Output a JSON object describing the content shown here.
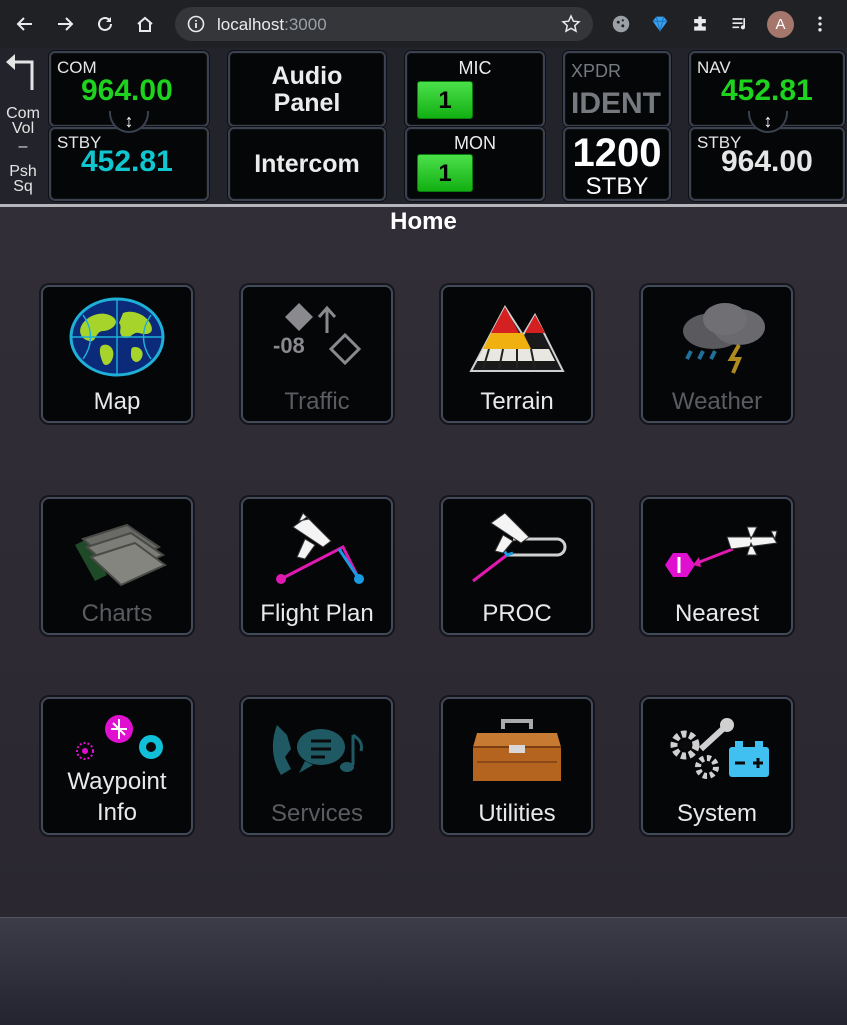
{
  "browser": {
    "url_host": "localhost",
    "url_port": ":3000",
    "avatar_letter": "A"
  },
  "side_control": {
    "line1": "Com",
    "line2": "Vol",
    "line3": "–",
    "line4": "Psh",
    "line5": "Sq"
  },
  "com": {
    "label": "COM",
    "active": "964.00",
    "standby_label": "STBY",
    "standby": "452.81"
  },
  "audio": {
    "panel_line1": "Audio",
    "panel_line2": "Panel",
    "intercom": "Intercom"
  },
  "mic": {
    "label": "MIC",
    "value": "1"
  },
  "mon": {
    "label": "MON",
    "value": "1"
  },
  "xpdr": {
    "label": "XPDR",
    "ident": "IDENT",
    "code": "1200",
    "mode": "STBY"
  },
  "nav": {
    "label": "NAV",
    "active": "452.81",
    "standby_label": "STBY",
    "standby": "964.00"
  },
  "page_title": "Home",
  "apps": [
    {
      "label": "Map",
      "enabled": true,
      "icon": "globe-icon"
    },
    {
      "label": "Traffic",
      "enabled": false,
      "icon": "traffic-icon",
      "icon_text": "-08"
    },
    {
      "label": "Terrain",
      "enabled": true,
      "icon": "terrain-icon"
    },
    {
      "label": "Weather",
      "enabled": false,
      "icon": "weather-icon"
    },
    {
      "label": "Charts",
      "enabled": false,
      "icon": "charts-icon"
    },
    {
      "label": "Flight Plan",
      "enabled": true,
      "icon": "flight-plan-icon"
    },
    {
      "label": "PROC",
      "enabled": true,
      "icon": "procedure-icon"
    },
    {
      "label": "Nearest",
      "enabled": true,
      "icon": "nearest-icon"
    },
    {
      "label_line1": "Waypoint",
      "label_line2": "Info",
      "enabled": true,
      "icon": "waypoint-icon"
    },
    {
      "label": "Services",
      "enabled": false,
      "icon": "services-icon"
    },
    {
      "label": "Utilities",
      "enabled": true,
      "icon": "toolbox-icon"
    },
    {
      "label": "System",
      "enabled": true,
      "icon": "system-icon"
    }
  ],
  "colors": {
    "active_freq": "#1ed31e",
    "standby_freq": "#10c7d0",
    "disabled_label": "#5c5c60"
  }
}
